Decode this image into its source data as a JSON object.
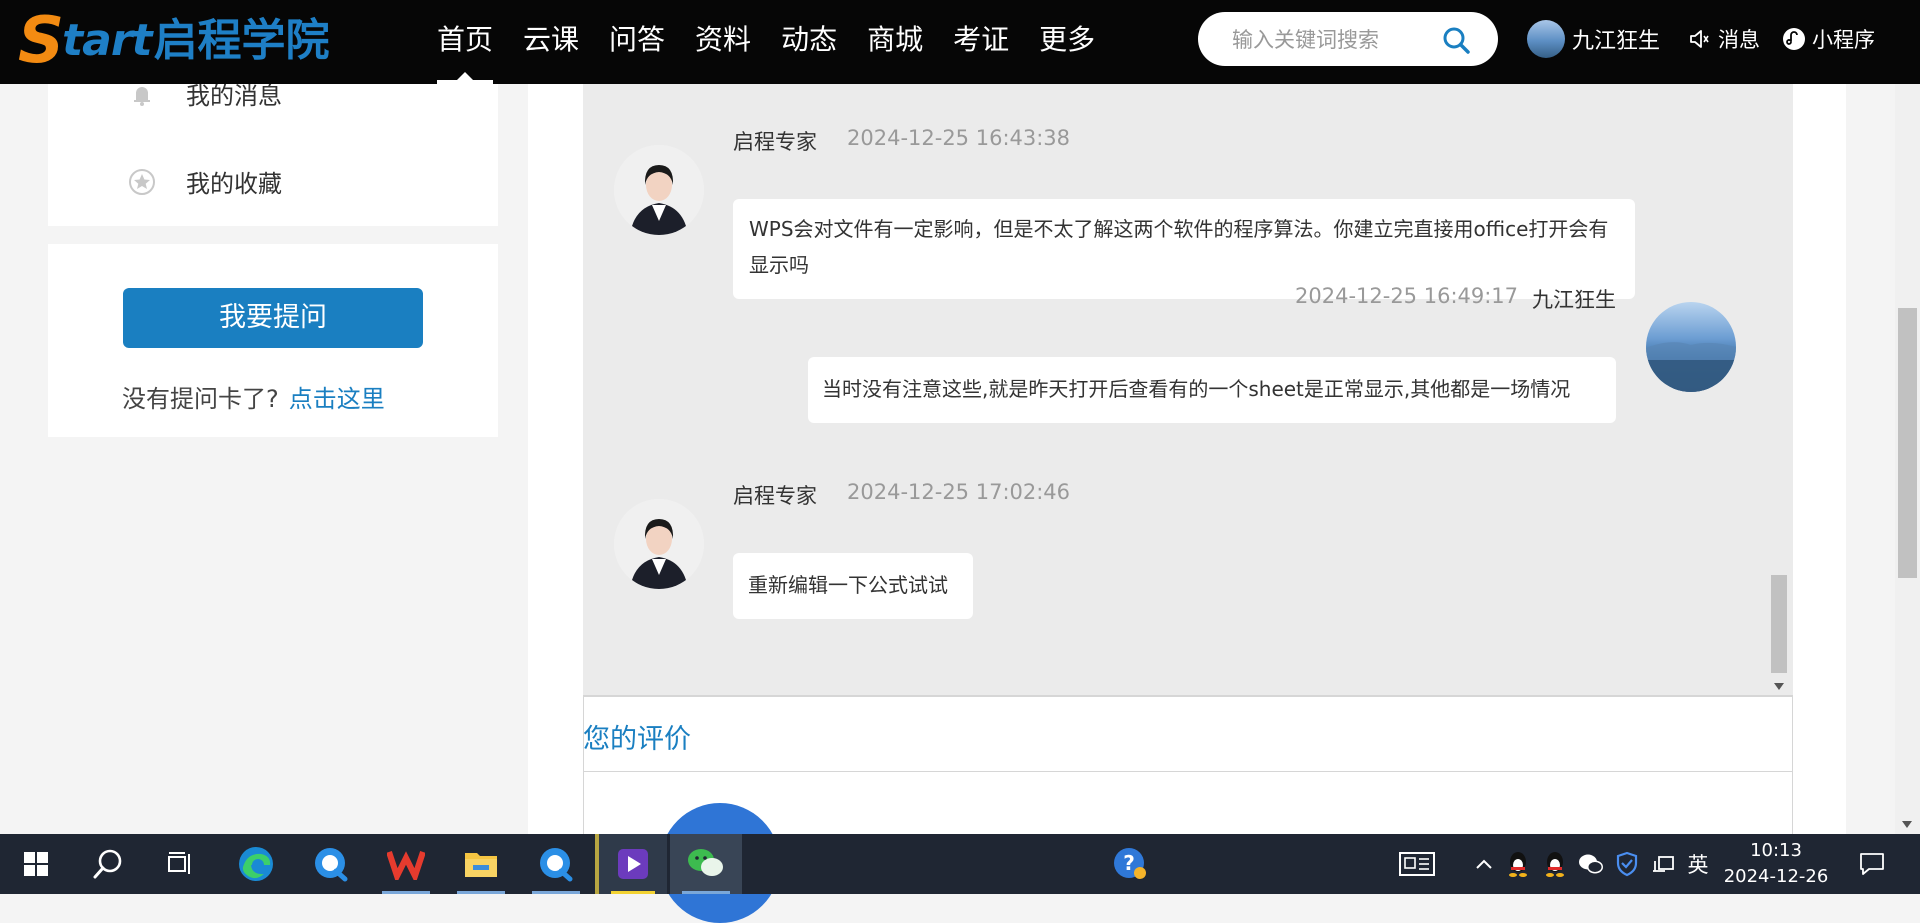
{
  "header": {
    "logo_s": "S",
    "logo_tart": "tart",
    "logo_cn": "启程学院",
    "nav": [
      "首页",
      "云课",
      "问答",
      "资料",
      "动态",
      "商城",
      "考证",
      "更多"
    ],
    "search_placeholder": "输入关键词搜索",
    "user_name": "九江狂生",
    "messages_label": "消息",
    "mini_program_label": "小程序"
  },
  "sidebar": {
    "my_messages": "我的消息",
    "my_favorites": "我的收藏",
    "ask_button": "我要提问",
    "no_card_text": "没有提问卡了?",
    "click_here": "点击这里"
  },
  "chat": [
    {
      "role": "expert",
      "name": "启程专家",
      "time": "2024-12-25 16:43:38",
      "text": "WPS会对文件有一定影响，但是不太了解这两个软件的程序算法。你建立完直接用office打开会有显示吗"
    },
    {
      "role": "user",
      "name": "九江狂生",
      "time": "2024-12-25 16:49:17",
      "text": "当时没有注意这些,就是昨天打开后查看有的一个sheet是正常显示,其他都是一场情况"
    },
    {
      "role": "expert",
      "name": "启程专家",
      "time": "2024-12-25 17:02:46",
      "text": "重新编辑一下公式试试"
    }
  ],
  "rating": {
    "title": "您的评价"
  },
  "taskbar": {
    "time": "10:13",
    "date": "2024-12-26",
    "ime": "英"
  },
  "colors": {
    "accent": "#1a7fc1",
    "nav_bg": "#060606",
    "taskbar_bg": "#1f2633",
    "logo_orange": "#f38b12"
  }
}
